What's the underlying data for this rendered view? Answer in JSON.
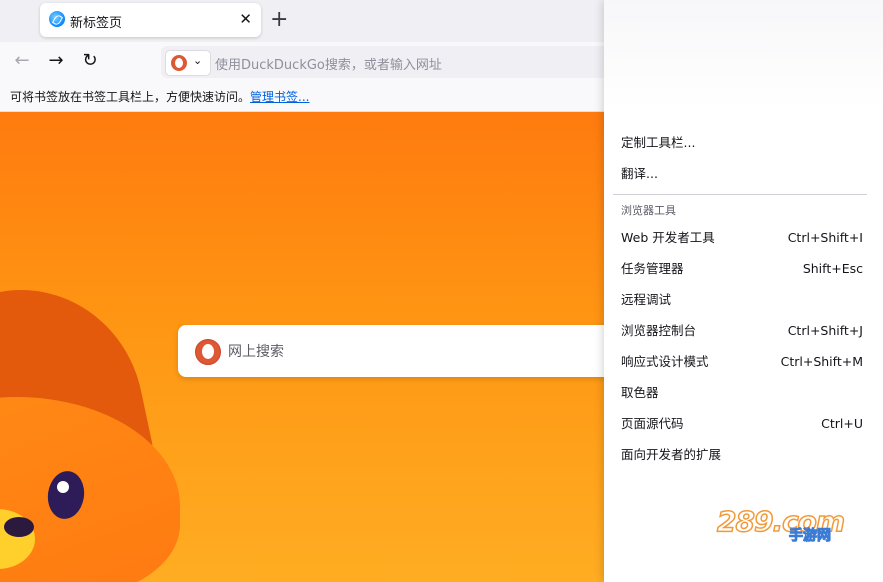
{
  "tab": {
    "title": "新标签页",
    "close_glyph": "✕"
  },
  "new_tab_glyph": "+",
  "nav": {
    "back_glyph": "←",
    "forward_glyph": "→",
    "reload_glyph": "↻"
  },
  "urlbar": {
    "placeholder": "使用DuckDuckGo搜索，或者输入网址",
    "chevron": "⌄"
  },
  "bookmarks_bar": {
    "text": "可将书签放在书签工具栏上，方便快速访问。",
    "link": "管理书签..."
  },
  "page": {
    "search_placeholder": "网上搜索"
  },
  "menu": {
    "top_items": [
      {
        "label": "定制工具栏..."
      },
      {
        "label": "翻译..."
      }
    ],
    "section_header": "浏览器工具",
    "tool_items": [
      {
        "label": "Web 开发者工具",
        "shortcut": "Ctrl+Shift+I"
      },
      {
        "label": "任务管理器",
        "shortcut": "Shift+Esc"
      },
      {
        "label": "远程调试",
        "shortcut": ""
      },
      {
        "label": "浏览器控制台",
        "shortcut": "Ctrl+Shift+J"
      },
      {
        "label": "响应式设计模式",
        "shortcut": "Ctrl+Shift+M"
      },
      {
        "label": "取色器",
        "shortcut": ""
      },
      {
        "label": "页面源代码",
        "shortcut": "Ctrl+U"
      },
      {
        "label": "面向开发者的扩展",
        "shortcut": ""
      }
    ]
  },
  "watermark": {
    "main": "289.com",
    "sub": "手游网"
  },
  "colors": {
    "accent_orange": "#ff8a14",
    "link_blue": "#0061e0",
    "ddg_red": "#de5833"
  }
}
